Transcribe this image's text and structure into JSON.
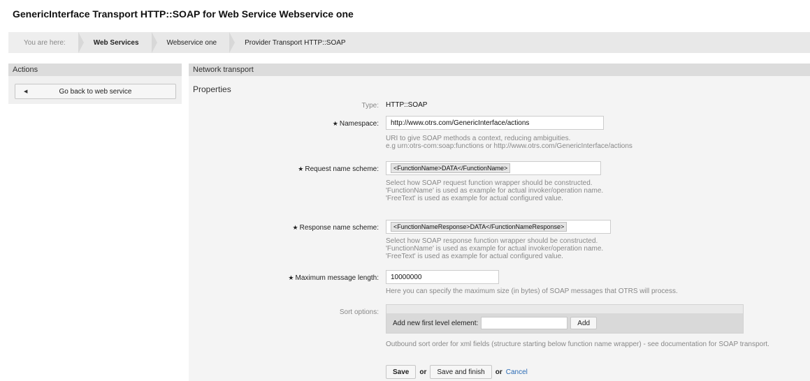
{
  "page": {
    "title": "GenericInterface Transport HTTP::SOAP for Web Service Webservice one"
  },
  "breadcrumb": {
    "items": [
      {
        "label": "You are here:"
      },
      {
        "label": "Web Services"
      },
      {
        "label": "Webservice one"
      },
      {
        "label": "Provider Transport HTTP::SOAP"
      }
    ]
  },
  "sidebar": {
    "header": "Actions",
    "back_button": "Go back to web service",
    "back_icon": "chevron-left-icon"
  },
  "main": {
    "header": "Network transport",
    "section_title": "Properties",
    "type": {
      "label": "Type:",
      "value": "HTTP::SOAP"
    },
    "namespace": {
      "label": "Namespace:",
      "value": "http://www.otrs.com/GenericInterface/actions",
      "help_1": "URI to give SOAP methods a context, reducing ambiguities.",
      "help_2": "e.g urn:otrs-com:soap:functions or http://www.otrs.com/GenericInterface/actions"
    },
    "request_scheme": {
      "label": "Request name scheme:",
      "value": "<FunctionName>DATA</FunctionName>",
      "help_1": "Select how SOAP request function wrapper should be constructed.",
      "help_2": "'FunctionName' is used as example for actual invoker/operation name.",
      "help_3": "'FreeText' is used as example for actual configured value."
    },
    "response_scheme": {
      "label": "Response name scheme:",
      "value": "<FunctionNameResponse>DATA</FunctionNameResponse>",
      "help_1": "Select how SOAP response function wrapper should be constructed.",
      "help_2": "'FunctionName' is used as example for actual invoker/operation name.",
      "help_3": "'FreeText' is used as example for actual configured value."
    },
    "max_length": {
      "label": "Maximum message length:",
      "value": "10000000",
      "help": "Here you can specify the maximum size (in bytes) of SOAP messages that OTRS will process."
    },
    "sort_options": {
      "label": "Sort options:",
      "add_label": "Add new first level element:",
      "add_value": "",
      "add_button": "Add",
      "help": "Outbound sort order for xml fields (structure starting below function name wrapper) - see documentation for SOAP transport."
    },
    "actions": {
      "save": "Save",
      "or_1": "or",
      "save_finish": "Save and finish",
      "or_2": "or",
      "cancel": "Cancel"
    }
  },
  "colors": {
    "link": "#2a6bb5",
    "header_bg": "#dcdcdc",
    "panel_bg": "#f4f4f4"
  }
}
